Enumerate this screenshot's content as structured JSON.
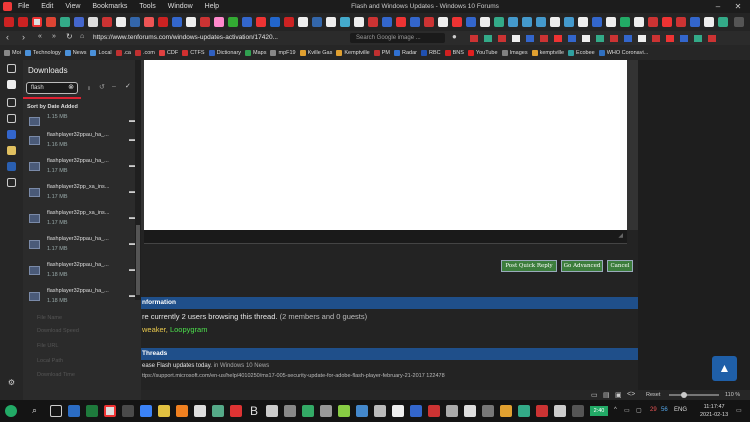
{
  "app": {
    "title": "Flash and Windows Updates - Windows 10 Forums"
  },
  "menu": [
    "File",
    "Edit",
    "View",
    "Bookmarks",
    "Tools",
    "Window",
    "Help"
  ],
  "address": {
    "url": "https://www.tenforums.com/windows-updates-activation/17420...",
    "search_placeholder": "Search Google image ..."
  },
  "bookmarks": [
    {
      "label": "Moi",
      "color": "#888888"
    },
    {
      "label": "Technology",
      "color": "#4a90d9"
    },
    {
      "label": "News",
      "color": "#4a90d9"
    },
    {
      "label": "Local",
      "color": "#4a90d9"
    },
    {
      "label": ".ca",
      "color": "#c03030"
    },
    {
      "label": ".com",
      "color": "#c03030"
    },
    {
      "label": "CDF",
      "color": "#e04040"
    },
    {
      "label": "CTFS",
      "color": "#d03030"
    },
    {
      "label": "Dictionary",
      "color": "#3060c0"
    },
    {
      "label": "Maps",
      "color": "#30a050"
    },
    {
      "label": "mpF19",
      "color": "#888888"
    },
    {
      "label": "Kville Gas",
      "color": "#e0a030"
    },
    {
      "label": "Kemptville",
      "color": "#e0a030"
    },
    {
      "label": "PM",
      "color": "#c03030"
    },
    {
      "label": "Radar",
      "color": "#3070d0"
    },
    {
      "label": "RBC",
      "color": "#2050b0"
    },
    {
      "label": "BNS",
      "color": "#d02020"
    },
    {
      "label": "YouTube",
      "color": "#e02020"
    },
    {
      "label": "Images",
      "color": "#808080"
    },
    {
      "label": "kemptville",
      "color": "#e0a030"
    },
    {
      "label": "Ecobee",
      "color": "#30a0a0"
    },
    {
      "label": "WHO Coronavi...",
      "color": "#3070c0"
    }
  ],
  "downloads": {
    "title": "Downloads",
    "filter": "flash",
    "sort_label": "Sort by Date Added",
    "items": [
      {
        "name": "",
        "size": "1.15 MB"
      },
      {
        "name": "flashplayer32ppau_ha_...",
        "size": "1.16 MB"
      },
      {
        "name": "flashplayer32ppau_ha_...",
        "size": "1.17 MB"
      },
      {
        "name": "flashplayer32pp_xa_ins...",
        "size": "1.17 MB"
      },
      {
        "name": "flashplayer32pp_xa_ins...",
        "size": "1.17 MB"
      },
      {
        "name": "flashplayer32ppau_ha_...",
        "size": "1.17 MB"
      },
      {
        "name": "flashplayer32ppau_ha_...",
        "size": "1.18 MB"
      },
      {
        "name": "flashplayer32ppau_ha_...",
        "size": "1.18 MB"
      }
    ],
    "meta_labels": [
      "File Name",
      "Download Speed",
      "File URL",
      "Local Path",
      "Download Time"
    ]
  },
  "forum": {
    "buttons": [
      "Post Quick Reply",
      "Go Advanced",
      "Cancel"
    ],
    "info_header": "nformation",
    "info_text": "re currently 2 users browsing this thread.",
    "info_counts": "(2 members and 0 guests)",
    "user1": "weaker,",
    "user2": "Loopygram",
    "threads_header": "Threads",
    "thread1_title": "ease Flash updates today.",
    "thread1_forum": "in Windows 10 News",
    "thread1_url": "ttps://support.microsoft.com/en-us/help/4010250/ms17-005-security-update-for-adobe-flash-player-february-21-2017 122478"
  },
  "status": {
    "zoom": "110 %",
    "reset": "Reset"
  },
  "taskbar": {
    "time": "11:17:47",
    "date": "2021-02-13",
    "lang": "ENG",
    "badge": "2:40",
    "num1": "29",
    "num2": "56"
  }
}
